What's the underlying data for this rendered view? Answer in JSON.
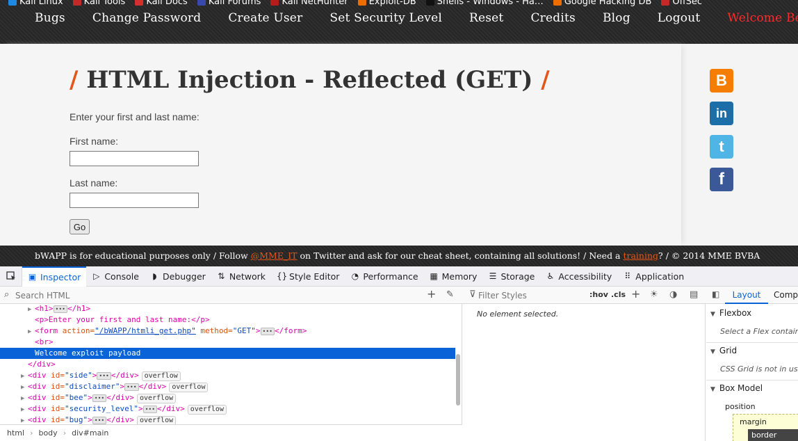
{
  "bookmarks": [
    "Kali Linux",
    "Kali Tools",
    "Kali Docs",
    "Kali Forums",
    "Kali NetHunter",
    "Exploit-DB",
    "Shells - Windows - Ha…",
    "Google Hacking DB",
    "OffSec"
  ],
  "nav": {
    "items": [
      "Bugs",
      "Change Password",
      "Create User",
      "Set Security Level",
      "Reset",
      "Credits",
      "Blog",
      "Logout"
    ],
    "welcome": "Welcome Bee"
  },
  "page": {
    "title": "HTML Injection - Reflected (GET)",
    "slash": "/",
    "intro": "Enter your first and last name:",
    "first_label": "First name:",
    "last_label": "Last name:",
    "go_label": "Go"
  },
  "social": {
    "blogger": "B",
    "linkedin": "in",
    "twitter": "t",
    "facebook": "f"
  },
  "footer": {
    "part1": "bWAPP is for educational purposes only / Follow ",
    "handle": "@MME_IT",
    "part2": " on Twitter and ask for our cheat sheet, containing all solutions! / Need a ",
    "training": "training",
    "part3": "? / © 2014 MME BVBA"
  },
  "devtools": {
    "tabs": [
      {
        "label": "Inspector",
        "icon": "▣"
      },
      {
        "label": "Console",
        "icon": "▷"
      },
      {
        "label": "Debugger",
        "icon": "◗"
      },
      {
        "label": "Network",
        "icon": "⇅"
      },
      {
        "label": "Style Editor",
        "icon": "{}"
      },
      {
        "label": "Performance",
        "icon": "◔"
      },
      {
        "label": "Memory",
        "icon": "▦"
      },
      {
        "label": "Storage",
        "icon": "☰"
      },
      {
        "label": "Accessibility",
        "icon": "♿"
      },
      {
        "label": "Application",
        "icon": "⠿"
      }
    ],
    "search_placeholder": "Search HTML",
    "filter_placeholder": "Filter Styles",
    "hov": ":hov",
    "cls": ".cls",
    "markup": {
      "r1_tag": "<h1>",
      "r1_close": "</h1>",
      "r2": "<p>Enter your first and last name:</p>",
      "r3_open": "<form ",
      "r3_attr1": "action=",
      "r3_val1": "\"/bWAPP/htmli_get.php\"",
      "r3_attr2": " method=",
      "r3_val2": "\"GET\"",
      "r3_close": "</form>",
      "r4": "<br>",
      "r5": "Welcome exploit payload",
      "r6": "</div>",
      "r7_id": "\"side\"",
      "r8_id": "\"disclaimer\"",
      "r9_id": "\"bee\"",
      "r10_id": "\"security_level\"",
      "r11_id": "\"bug\"",
      "div_open": "<div ",
      "id_attr": "id=",
      "div_close": "</div>",
      "gt": ">",
      "ellipsis": "•••",
      "overflow": "overflow"
    },
    "breadcrumbs": [
      "html",
      "body",
      "div#main"
    ],
    "no_element": "No element selected.",
    "layout": {
      "tab_layout": "Layout",
      "tab_computed": "Computed",
      "flexbox": "Flexbox",
      "flexbox_body": "Select a Flex container",
      "grid": "Grid",
      "grid_body": "CSS Grid is not in use",
      "boxmodel": "Box Model",
      "position": "position",
      "margin": "margin",
      "border": "border"
    }
  }
}
